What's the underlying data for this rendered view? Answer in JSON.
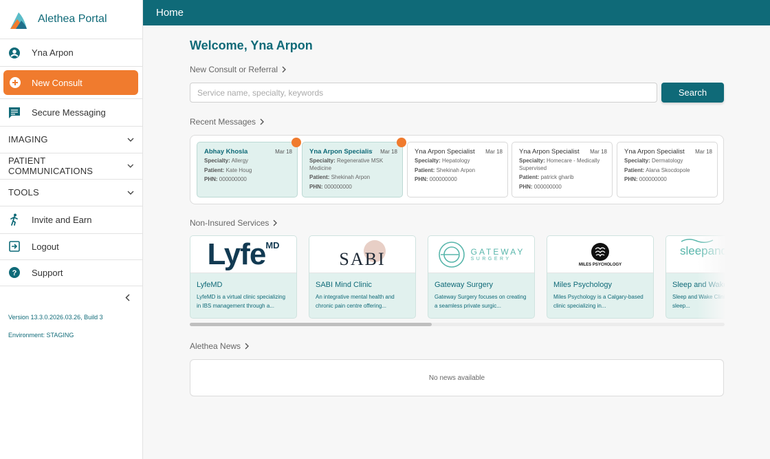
{
  "app": {
    "name": "Alethea Portal"
  },
  "header": {
    "title": "Home"
  },
  "sidebar": {
    "user_name": "Yna Arpon",
    "new_consult": "New Consult",
    "secure_messaging": "Secure Messaging",
    "sections": [
      "IMAGING",
      "PATIENT COMMUNICATIONS",
      "TOOLS"
    ],
    "invite": "Invite and Earn",
    "logout": "Logout",
    "support": "Support",
    "version": "Version 13.3.0.2026.03.26, Build 3",
    "environment": "Environment: STAGING"
  },
  "main": {
    "welcome": "Welcome, Yna Arpon",
    "consult_link": "New Consult or Referral",
    "search_placeholder": "Service name, specialty, keywords",
    "search_button": "Search",
    "messages_link": "Recent Messages",
    "services_link": "Non-Insured Services",
    "news_link": "Alethea News",
    "news_empty": "No news available"
  },
  "labels": {
    "specialty": "Specialty:",
    "patient": "Patient:",
    "phn": "PHN:"
  },
  "messages": [
    {
      "from": "Abhay Khosla",
      "date": "Mar 18",
      "specialty": "Allergy",
      "patient": "Kate Houg",
      "phn": "000000000",
      "unread": true
    },
    {
      "from": "Yna Arpon Specialist",
      "date": "Mar 18",
      "specialty": "Regenerative MSK Medicine",
      "patient": "Shekinah Arpon",
      "phn": "000000000",
      "unread": true
    },
    {
      "from": "Yna Arpon Specialist",
      "date": "Mar 18",
      "specialty": "Hepatology",
      "patient": "Shekinah Arpon",
      "phn": "000000000",
      "unread": false
    },
    {
      "from": "Yna Arpon Specialist",
      "date": "Mar 18",
      "specialty": "Homecare - Medically Supervised",
      "patient": "patrick gharib",
      "phn": "000000000",
      "unread": false
    },
    {
      "from": "Yna Arpon Specialist",
      "date": "Mar 18",
      "specialty": "Dermatology",
      "patient": "Alana Skocdopole",
      "phn": "000000000",
      "unread": false
    }
  ],
  "services": [
    {
      "name": "LyfeMD",
      "desc": "LyfeMD is a virtual clinic specializing in IBS management through a...",
      "logo_text": "Lyfe",
      "logo_sup": "MD"
    },
    {
      "name": "SABI Mind Clinic",
      "desc": "An integrative mental health and chronic pain centre offering...",
      "logo_text": "SABI"
    },
    {
      "name": "Gateway Surgery",
      "desc": "Gateway Surgery focuses on creating a seamless private surgic...",
      "logo_text": "GATEWAY",
      "logo_sub": "SURGERY"
    },
    {
      "name": "Miles Psychology",
      "desc": "Miles Psychology is a Calgary-based clinic specializing in...",
      "logo_text": "MILES PSYCHOLOGY"
    },
    {
      "name": "Sleep and Wake Clinic",
      "desc": "Sleep and Wake Clinic subspecialised sleep...",
      "logo_text": "sleepandwake"
    }
  ],
  "colors": {
    "primary": "#0f6a78",
    "accent": "#f07b2e",
    "card_bg": "#e1f1ee"
  },
  "icons": [
    "user-circle-icon",
    "plus-circle-icon",
    "message-icon",
    "chevron-down-icon",
    "person-run-icon",
    "logout-icon",
    "help-icon",
    "chevron-left-icon",
    "chevron-right-icon"
  ]
}
